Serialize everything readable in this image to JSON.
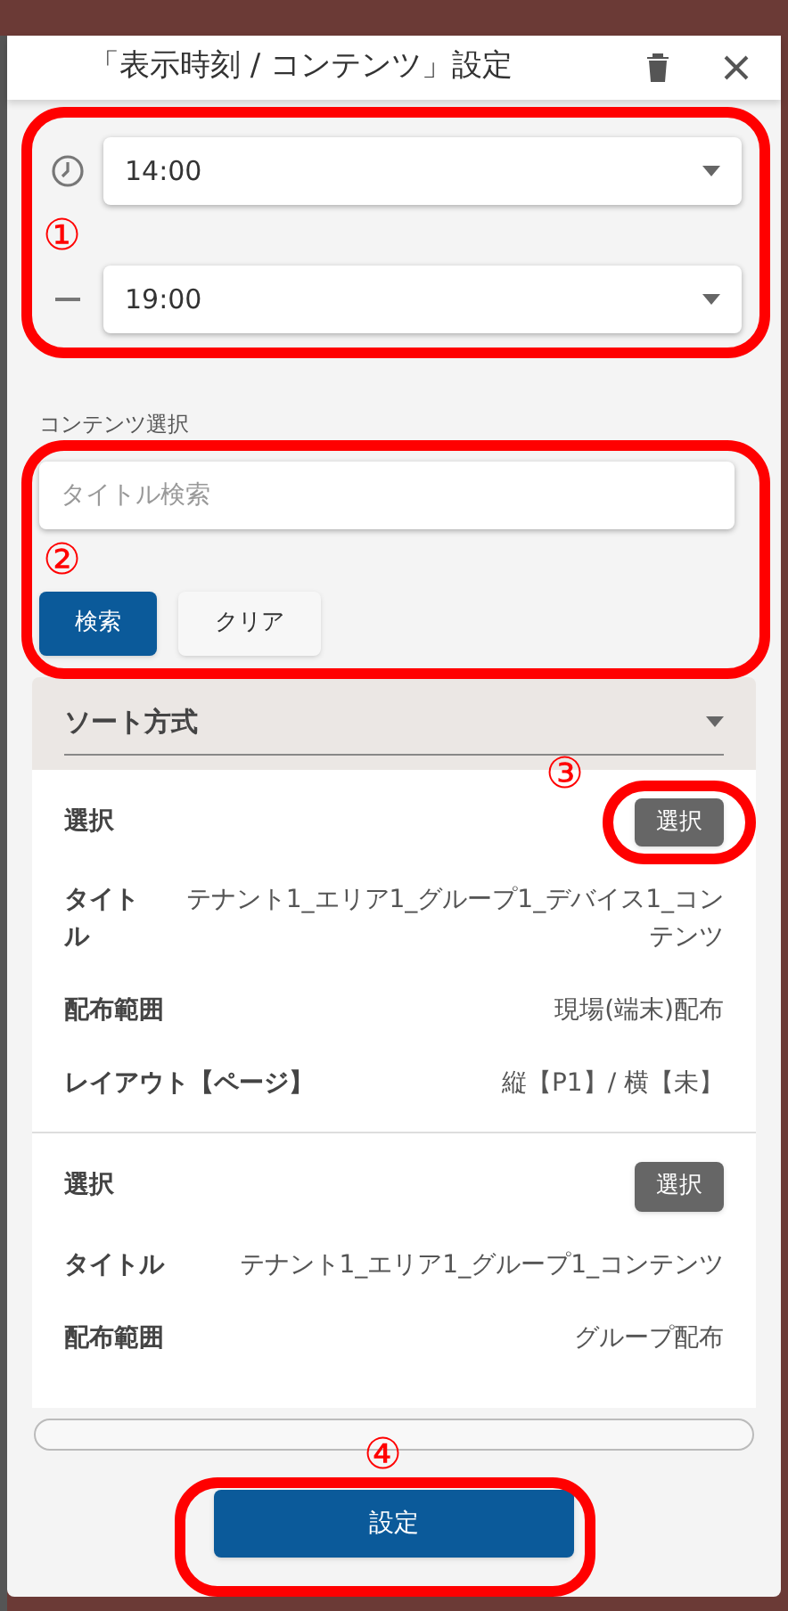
{
  "dialog": {
    "title": "「表示時刻 / コンテンツ」設定"
  },
  "time_range": {
    "start": "14:00",
    "end": "19:00"
  },
  "content_selection": {
    "label": "コンテンツ選択",
    "search": {
      "placeholder": "タイトル検索"
    },
    "buttons": [
      {
        "label": "検索",
        "kind": "primary"
      },
      {
        "label": "クリア",
        "kind": "secondary"
      }
    ]
  },
  "sort": {
    "label": "ソート方式"
  },
  "items": [
    {
      "rows": [
        {
          "kind": "button",
          "label": "選択",
          "value": "選択"
        },
        {
          "kind": "text",
          "label": "タイトル",
          "value": "テナント1_エリア1_グループ1_デバイス1_コンテンツ"
        },
        {
          "kind": "text",
          "label": "配布範囲",
          "value": "現場(端末)配布"
        },
        {
          "kind": "text",
          "label": "レイアウト【ページ】",
          "value": "縦【P1】/ 横【未】"
        }
      ]
    },
    {
      "rows": [
        {
          "kind": "button",
          "label": "選択",
          "value": "選択"
        },
        {
          "kind": "text",
          "label": "タイトル",
          "value": "テナント1_エリア1_グループ1_コンテンツ"
        },
        {
          "kind": "text",
          "label": "配布範囲",
          "value": "グループ配布"
        }
      ]
    }
  ],
  "submit": {
    "label": "設定"
  },
  "annotations": [
    "①",
    "②",
    "③",
    "④"
  ]
}
